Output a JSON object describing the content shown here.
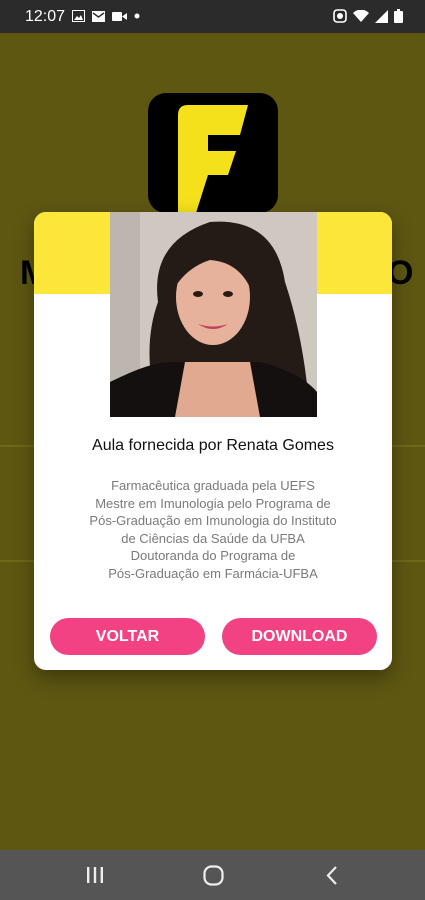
{
  "status_bar": {
    "time": "12:07",
    "left_icons": [
      "image-icon",
      "mail-icon",
      "video-icon",
      "dot-icon"
    ],
    "right_icons": [
      "alarm-icon",
      "wifi-icon",
      "signal-icon",
      "battery-icon"
    ]
  },
  "background": {
    "color": "#5e5712",
    "letters": [
      "M",
      "O"
    ]
  },
  "dialog": {
    "title": "Aula fornecida por Renata Gomes",
    "bio_lines": [
      "Farmacêutica graduada pela UEFS",
      "Mestre em Imunologia pelo Programa de",
      "Pós-Graduação em Imunologia do Instituto",
      "de Ciências da Saúde da UFBA",
      "Doutoranda do Programa de",
      "Pós-Graduação em Farmácia-UFBA"
    ],
    "buttons": {
      "back": "VOLTAR",
      "download": "DOWNLOAD"
    },
    "accent_color": "#fde63a",
    "button_color": "#f24284"
  },
  "nav_bar": {
    "icons": [
      "recent-apps-icon",
      "home-icon",
      "back-icon"
    ]
  }
}
